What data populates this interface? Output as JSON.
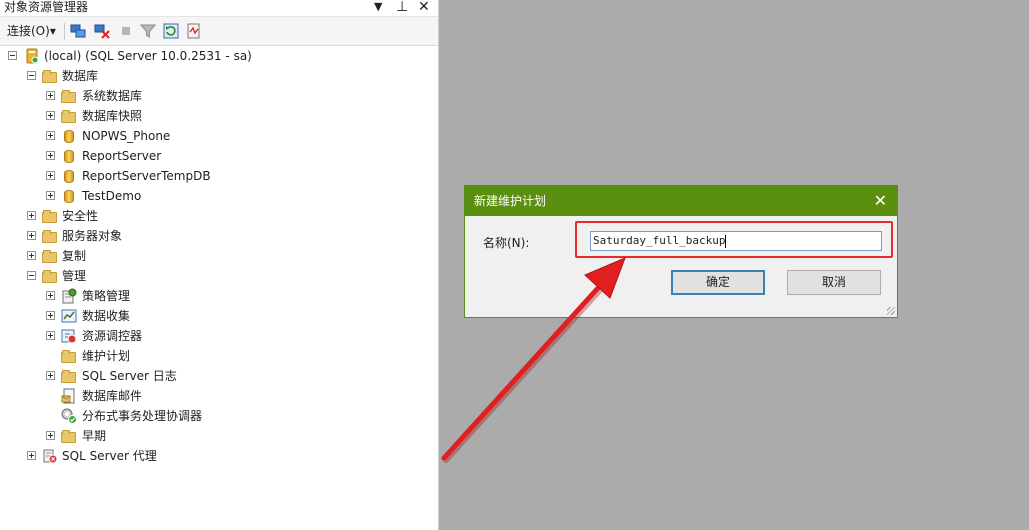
{
  "explorer": {
    "title": "对象资源管理器",
    "controls": {
      "dropdown": "▼",
      "pin": "⊥",
      "close": "✕"
    },
    "toolbar": {
      "connect_label": "连接(O)",
      "connect_arrow": "▾"
    }
  },
  "tree": {
    "server": "(local) (SQL Server 10.0.2531 - sa)",
    "databases": "数据库",
    "system_databases": "系统数据库",
    "database_snapshots": "数据库快照",
    "db_nopws": "NOPWS_Phone",
    "db_reportserver": "ReportServer",
    "db_reportservertemp": "ReportServerTempDB",
    "db_testdemo": "TestDemo",
    "security": "安全性",
    "server_objects": "服务器对象",
    "replication": "复制",
    "management": "管理",
    "policy_management": "策略管理",
    "data_collection": "数据收集",
    "resource_governor": "资源调控器",
    "maintenance_plans": "维护计划",
    "sql_server_logs": "SQL Server 日志",
    "database_mail": "数据库邮件",
    "dtc": "分布式事务处理协调器",
    "legacy": "早期",
    "sql_agent": "SQL Server 代理"
  },
  "dialog": {
    "title": "新建维护计划",
    "close": "✕",
    "name_label": "名称(N):",
    "name_value": "Saturday_full_backup",
    "ok_label": "确定",
    "cancel_label": "取消"
  },
  "colors": {
    "dialog_title_bg": "#5a8f0f",
    "highlight": "#e52b2b",
    "arrow": "#e02020"
  }
}
